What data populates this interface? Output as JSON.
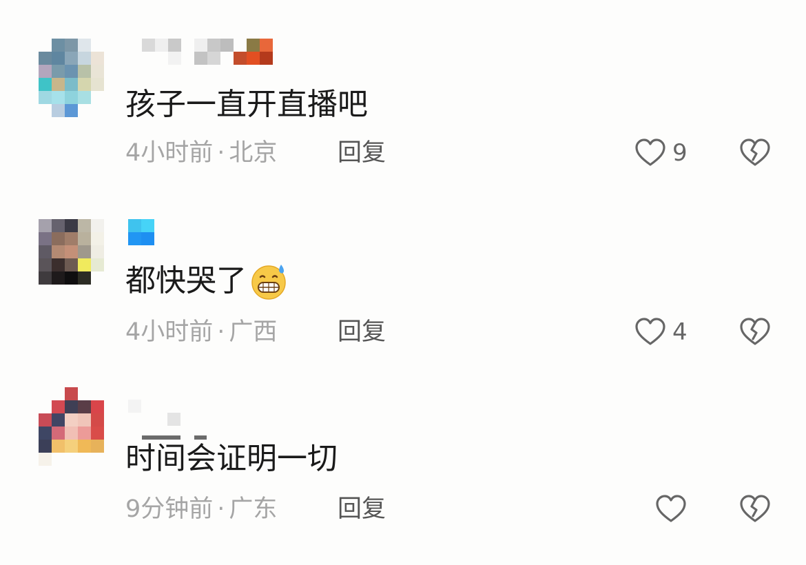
{
  "comments": [
    {
      "text": "孩子一直开直播吧",
      "time": "4小时前",
      "separator": "·",
      "location": "北京",
      "reply_label": "回复",
      "likes": "9",
      "has_emoji": false
    },
    {
      "text": "都快哭了",
      "time": "4小时前",
      "separator": "·",
      "location": "广西",
      "reply_label": "回复",
      "likes": "4",
      "has_emoji": true,
      "emoji": "grimacing-sweat-emoji"
    },
    {
      "text": "时间会证明一切",
      "time": "9分钟前",
      "separator": "·",
      "location": "广东",
      "reply_label": "回复",
      "likes": "",
      "has_emoji": false
    }
  ],
  "icons": {
    "like": "heart-outline-icon",
    "dislike": "broken-heart-icon"
  },
  "colors": {
    "background": "#fdfdfc",
    "text": "#1a1a1a",
    "meta": "#a5a5a5",
    "reply": "#555555",
    "icon": "#666666"
  }
}
